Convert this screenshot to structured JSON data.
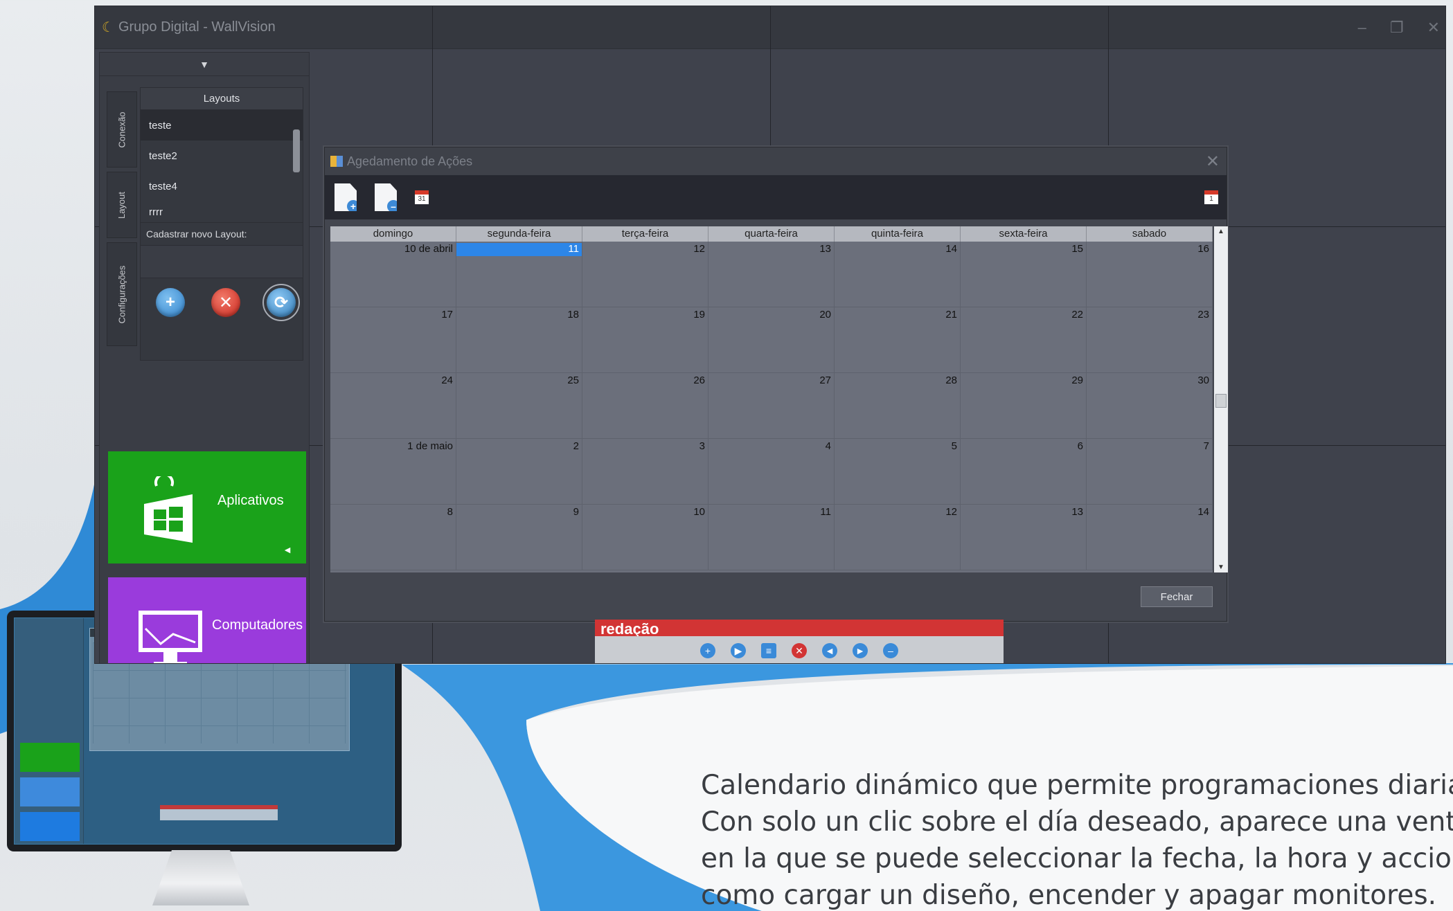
{
  "window": {
    "title": "Grupo Digital - WallVision"
  },
  "left_panel": {
    "side_tabs": [
      "Conexão",
      "Layout",
      "Configurações"
    ],
    "layouts_header": "Layouts",
    "layouts": [
      "teste",
      "teste2",
      "teste4",
      "rrrr"
    ],
    "new_layout_label": "Cadastrar novo Layout:",
    "tiles": {
      "apps": "Aplicativos",
      "computers": "Computadores"
    }
  },
  "dialog": {
    "title": "Agedamento de Ações",
    "weekdays": [
      "domingo",
      "segunda-feira",
      "terça-feira",
      "quarta-feira",
      "quinta-feira",
      "sexta-feira",
      "sabado"
    ],
    "weeks": [
      [
        "10 de abril",
        "11",
        "12",
        "13",
        "14",
        "15",
        "16"
      ],
      [
        "17",
        "18",
        "19",
        "20",
        "21",
        "22",
        "23"
      ],
      [
        "24",
        "25",
        "26",
        "27",
        "28",
        "29",
        "30"
      ],
      [
        "1 de maio",
        "2",
        "3",
        "4",
        "5",
        "6",
        "7"
      ],
      [
        "8",
        "9",
        "10",
        "11",
        "12",
        "13",
        "14"
      ]
    ],
    "today_label": "11",
    "close_button": "Fechar",
    "toolbar_calendar_icon": "31",
    "toolbar_calendar_icon_right": "1"
  },
  "media_bar": {
    "title_fragment": "redação"
  },
  "caption": {
    "lines": [
      "Calendario dinámico que permite programaciones diarias.",
      "Con solo un clic sobre el día deseado, aparece una ventana",
      "en la que se puede seleccionar la fecha, la hora y acciones",
      "como cargar un diseño, encender y apagar monitores."
    ]
  },
  "colors": {
    "accent_today": "#2d86e8",
    "tile_apps": "#1aa21a",
    "tile_computers": "#9a3bdc",
    "media_red": "#d23434"
  }
}
